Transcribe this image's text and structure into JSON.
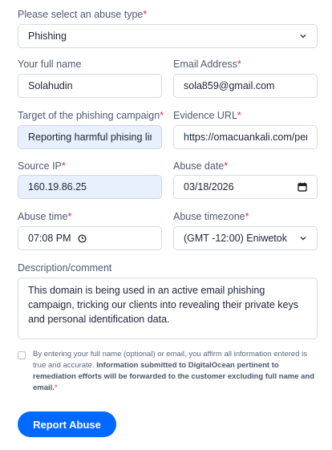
{
  "abuse_type": {
    "label": "Please select an abuse type",
    "required_mark": "*",
    "value": "Phishing"
  },
  "full_name": {
    "label": "Your full name",
    "value": "Solahudin"
  },
  "email": {
    "label": "Email Address",
    "required_mark": "*",
    "value": "sola859@gmail.com"
  },
  "target": {
    "label": "Target of the phishing campaign",
    "required_mark": "*",
    "value": "Reporting harmful phising link"
  },
  "evidence_url": {
    "label": "Evidence URL",
    "required_mark": "*",
    "value": "https://omacuankali.com/pen"
  },
  "source_ip": {
    "label": "Source IP",
    "required_mark": "*",
    "value": "160.19.86.25"
  },
  "abuse_date": {
    "label": "Abuse date",
    "required_mark": "*",
    "value": "03/18/2026"
  },
  "abuse_time": {
    "label": "Abuse time",
    "required_mark": "*",
    "value": "07:08 PM"
  },
  "abuse_timezone": {
    "label": "Abuse timezone",
    "required_mark": "*",
    "value": "(GMT -12:00) Eniwetok"
  },
  "description": {
    "label": "Description/comment",
    "value": "This domain is being used in an active email phishing campaign, tricking our clients into revealing their private keys and personal identification data."
  },
  "consent": {
    "text": "By entering your full name (optional) or email, you affirm all information entered is true and accurate.",
    "bold_text": "Information submitted to DigitalOcean pertinent to remediation efforts will be forwarded to the customer excluding full name and email.",
    "required_mark": "*"
  },
  "submit": {
    "label": "Report Abuse"
  },
  "colors": {
    "primary": "#0069ff",
    "required": "#e0245e",
    "filled_bg": "#e9f0fd"
  }
}
